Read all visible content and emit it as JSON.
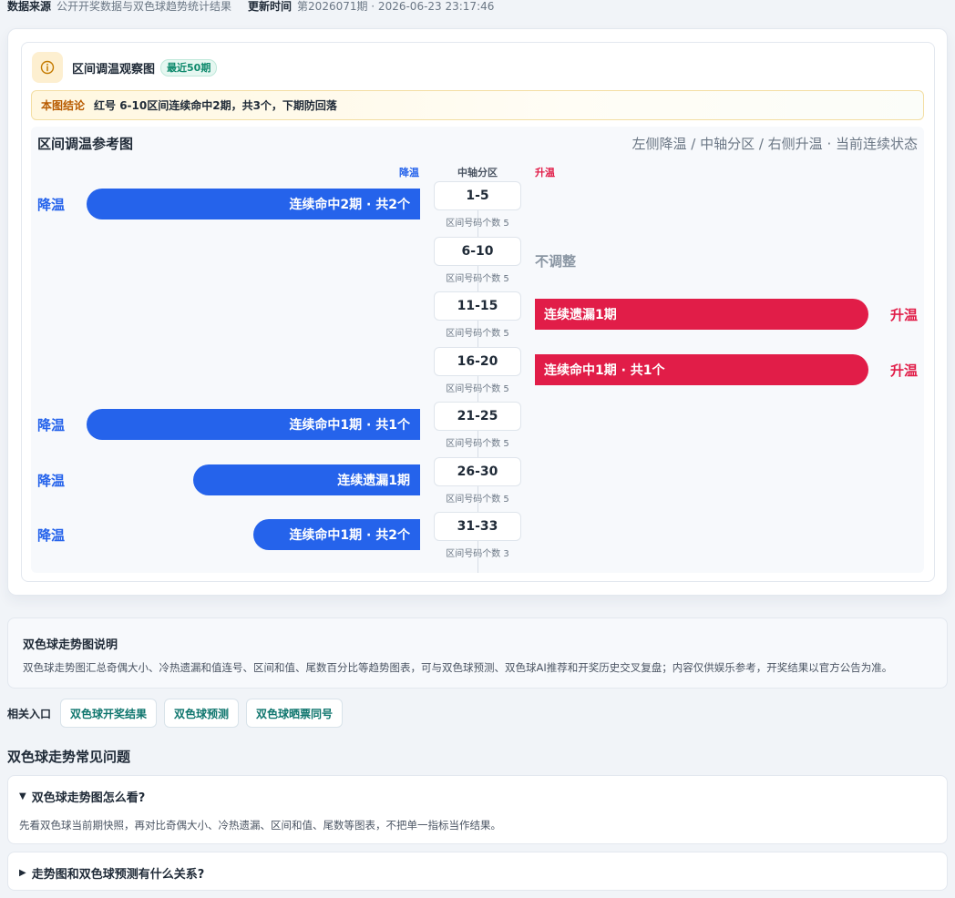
{
  "meta": {
    "source_label": "数据来源",
    "source_value": "公开开奖数据与双色球趋势统计结果",
    "update_label": "更新时间",
    "update_value": "第2026071期 · 2026-06-23 23:17:46"
  },
  "panel": {
    "title": "区间调温观察图",
    "badge": "最近50期",
    "info_icon": "info-icon",
    "conclusion_label": "本图结论",
    "conclusion_text": "红号 6-10区间连续命中2期，共3个，下期防回落"
  },
  "chart": {
    "title": "区间调温参考图",
    "subtitle": "左侧降温 / 中轴分区 / 右侧升温 · 当前连续状态",
    "col_cool": "降温",
    "col_center": "中轴分区",
    "col_warm": "升温",
    "cool_color": "#2563eb",
    "warm_color": "#e11d48",
    "rows": [
      {
        "zone": "1-5",
        "count_text": "区间号码个数 5",
        "direction": "cool",
        "side_label": "降温",
        "bar_text": "连续命中2期 · 共2个",
        "bar_level": 1.0
      },
      {
        "zone": "6-10",
        "count_text": "区间号码个数 5",
        "direction": "none",
        "status_text": "不调整"
      },
      {
        "zone": "11-15",
        "count_text": "区间号码个数 5",
        "direction": "warm",
        "side_label": "升温",
        "bar_text": "连续遗漏1期",
        "bar_level": 1.0
      },
      {
        "zone": "16-20",
        "count_text": "区间号码个数 5",
        "direction": "warm",
        "side_label": "升温",
        "bar_text": "连续命中1期 · 共1个",
        "bar_level": 1.0
      },
      {
        "zone": "21-25",
        "count_text": "区间号码个数 5",
        "direction": "cool",
        "side_label": "降温",
        "bar_text": "连续命中1期 · 共1个",
        "bar_level": 1.0
      },
      {
        "zone": "26-30",
        "count_text": "区间号码个数 5",
        "direction": "cool",
        "side_label": "降温",
        "bar_text": "连续遗漏1期",
        "bar_level": 0.68
      },
      {
        "zone": "31-33",
        "count_text": "区间号码个数 3",
        "direction": "cool",
        "side_label": "降温",
        "bar_text": "连续命中1期 · 共2个",
        "bar_level": 0.5
      }
    ]
  },
  "description": {
    "title": "双色球走势图说明",
    "text": "双色球走势图汇总奇偶大小、冷热遗漏和值连号、区间和值、尾数百分比等趋势图表，可与双色球预测、双色球AI推荐和开奖历史交叉复盘；内容仅供娱乐参考，开奖结果以官方公告为准。"
  },
  "related": {
    "label": "相关入口",
    "links": [
      "双色球开奖结果",
      "双色球预测",
      "双色球晒票同号"
    ]
  },
  "faq": {
    "heading": "双色球走势常见问题",
    "items": [
      {
        "question": "双色球走势图怎么看?",
        "answer": "先看双色球当前期快照，再对比奇偶大小、冷热遗漏、区间和值、尾数等图表，不把单一指标当作结果。",
        "expanded": true
      },
      {
        "question": "走势图和双色球预测有什么关系?",
        "expanded": false
      }
    ]
  }
}
